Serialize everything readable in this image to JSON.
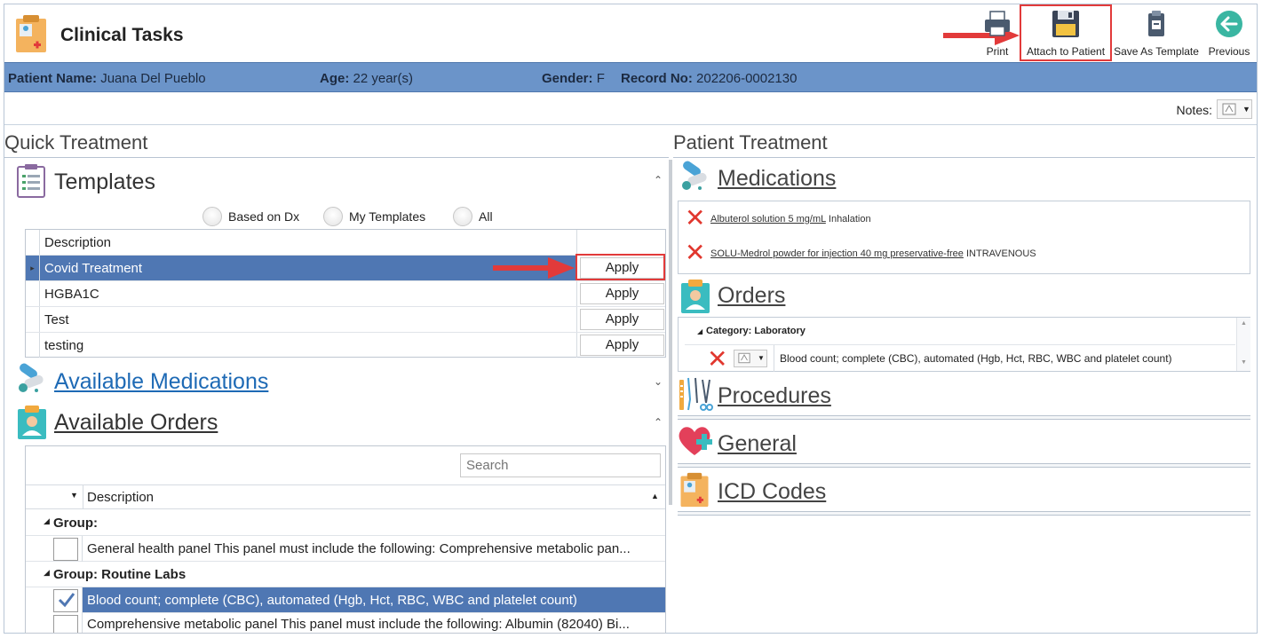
{
  "app": {
    "title": "Clinical Tasks"
  },
  "toolbar": {
    "print": "Print",
    "attach": "Attach to Patient",
    "save_template": "Save As Template",
    "previous": "Previous"
  },
  "patient": {
    "name_label": "Patient Name:",
    "name": "Juana Del Pueblo",
    "age_label": "Age:",
    "age": "22 year(s)",
    "gender_label": "Gender:",
    "gender": "F",
    "record_label": "Record No:",
    "record": "202206-0002130"
  },
  "notes": {
    "label": "Notes:"
  },
  "quick_treatment": {
    "heading": "Quick Treatment",
    "templates": {
      "heading": "Templates",
      "filters": [
        "Based on Dx",
        "My Templates",
        "All"
      ],
      "column": "Description",
      "rows": [
        {
          "description": "Covid Treatment",
          "action": "Apply"
        },
        {
          "description": "HGBA1C",
          "action": "Apply"
        },
        {
          "description": "Test",
          "action": "Apply"
        },
        {
          "description": "testing",
          "action": "Apply"
        }
      ]
    },
    "available_medications": "Available Medications",
    "available_orders": {
      "heading": "Available Orders",
      "search_placeholder": "Search",
      "column": "Description",
      "groups": [
        {
          "label": "Group:",
          "items": [
            {
              "text": "General health panel This panel must include the following: Comprehensive metabolic pan...",
              "checked": false
            }
          ]
        },
        {
          "label": "Group: Routine Labs",
          "items": [
            {
              "text": "Blood count; complete (CBC), automated (Hgb, Hct, RBC, WBC and platelet count)",
              "checked": true
            },
            {
              "text": "Comprehensive metabolic panel This panel must include the following: Albumin (82040) Bi...",
              "checked": false
            }
          ]
        }
      ]
    }
  },
  "patient_treatment": {
    "heading": "Patient Treatment",
    "medications": {
      "heading": "Medications",
      "items": [
        {
          "name": "Albuterol solution 5 mg/mL",
          "route": "Inhalation"
        },
        {
          "name": "SOLU-Medrol powder for injection 40 mg preservative-free",
          "route": "INTRAVENOUS"
        }
      ]
    },
    "orders": {
      "heading": "Orders",
      "category": "Category: Laboratory",
      "items": [
        {
          "text": "Blood count; complete (CBC), automated (Hgb, Hct, RBC, WBC and platelet count)"
        }
      ]
    },
    "procedures": "Procedures",
    "general": "General",
    "icd_codes": "ICD Codes"
  },
  "colors": {
    "patient_bar": "#6b94c9",
    "selection": "#4f77b3",
    "highlight": "#e23a3a",
    "link_blue": "#1e6ab5"
  },
  "icons": [
    "clinical-tasks-icon",
    "print-icon",
    "save-icon",
    "clipboard-icon",
    "back-arrow-icon",
    "templates-icon",
    "pills-icon",
    "doctor-icon",
    "surgical-tools-icon",
    "heart-plus-icon",
    "delete-x-icon",
    "notes-icon",
    "red-arrow-icon"
  ]
}
